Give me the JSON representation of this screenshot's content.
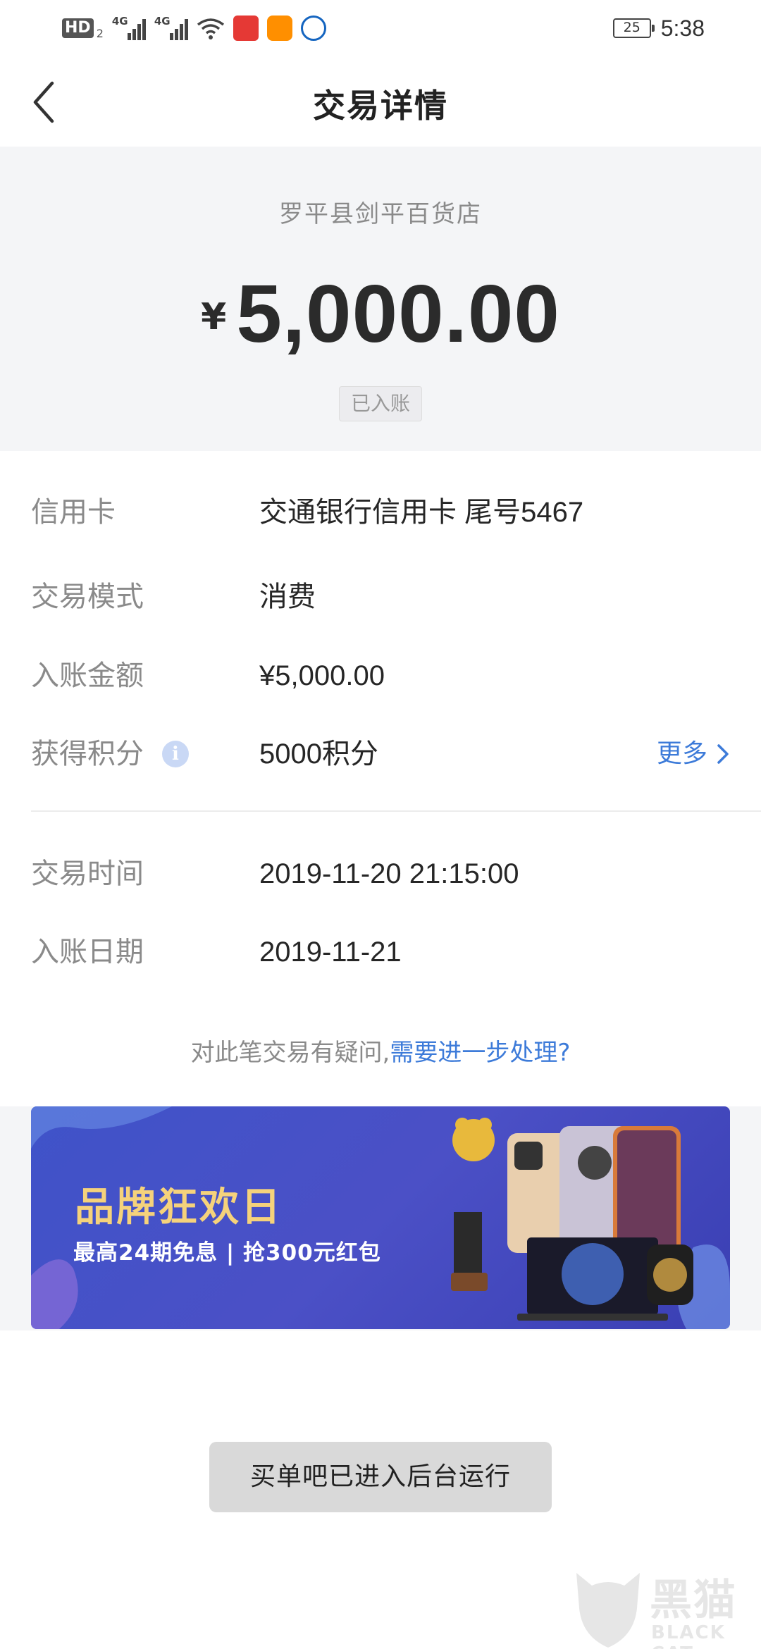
{
  "status_bar": {
    "hd": "HD",
    "hd_sub": "2",
    "sim1": "4G",
    "sim2": "4G",
    "battery": "25",
    "time": "5:38"
  },
  "nav": {
    "title": "交易详情",
    "back_icon": "chevron-left-icon"
  },
  "summary": {
    "merchant": "罗平县剑平百货店",
    "currency": "¥",
    "amount": "5,000.00",
    "status": "已入账"
  },
  "details": {
    "card_label": "信用卡",
    "card_value": "交通银行信用卡 尾号5467",
    "mode_label": "交易模式",
    "mode_value": "消费",
    "posted_amount_label": "入账金额",
    "posted_amount_value": "¥5,000.00",
    "points_label": "获得积分",
    "points_value": "5000积分",
    "more_label": "更多",
    "time_label": "交易时间",
    "time_value": "2019-11-20 21:15:00",
    "date_label": "入账日期",
    "date_value": "2019-11-21"
  },
  "query": {
    "prefix": "对此笔交易有疑问,",
    "link": "需要进一步处理?"
  },
  "banner": {
    "title": "品牌狂欢日",
    "subtitle": "最高24期免息 | 抢300元红包"
  },
  "toast": {
    "text": "买单吧已进入后台运行"
  },
  "watermark": {
    "text": "黑猫",
    "sub": "BLACK CAT"
  },
  "colors": {
    "accent": "#3d7bd9",
    "summary_bg": "#f4f5f7",
    "banner_bg": "#4450c4",
    "banner_title": "#f5d27b"
  }
}
